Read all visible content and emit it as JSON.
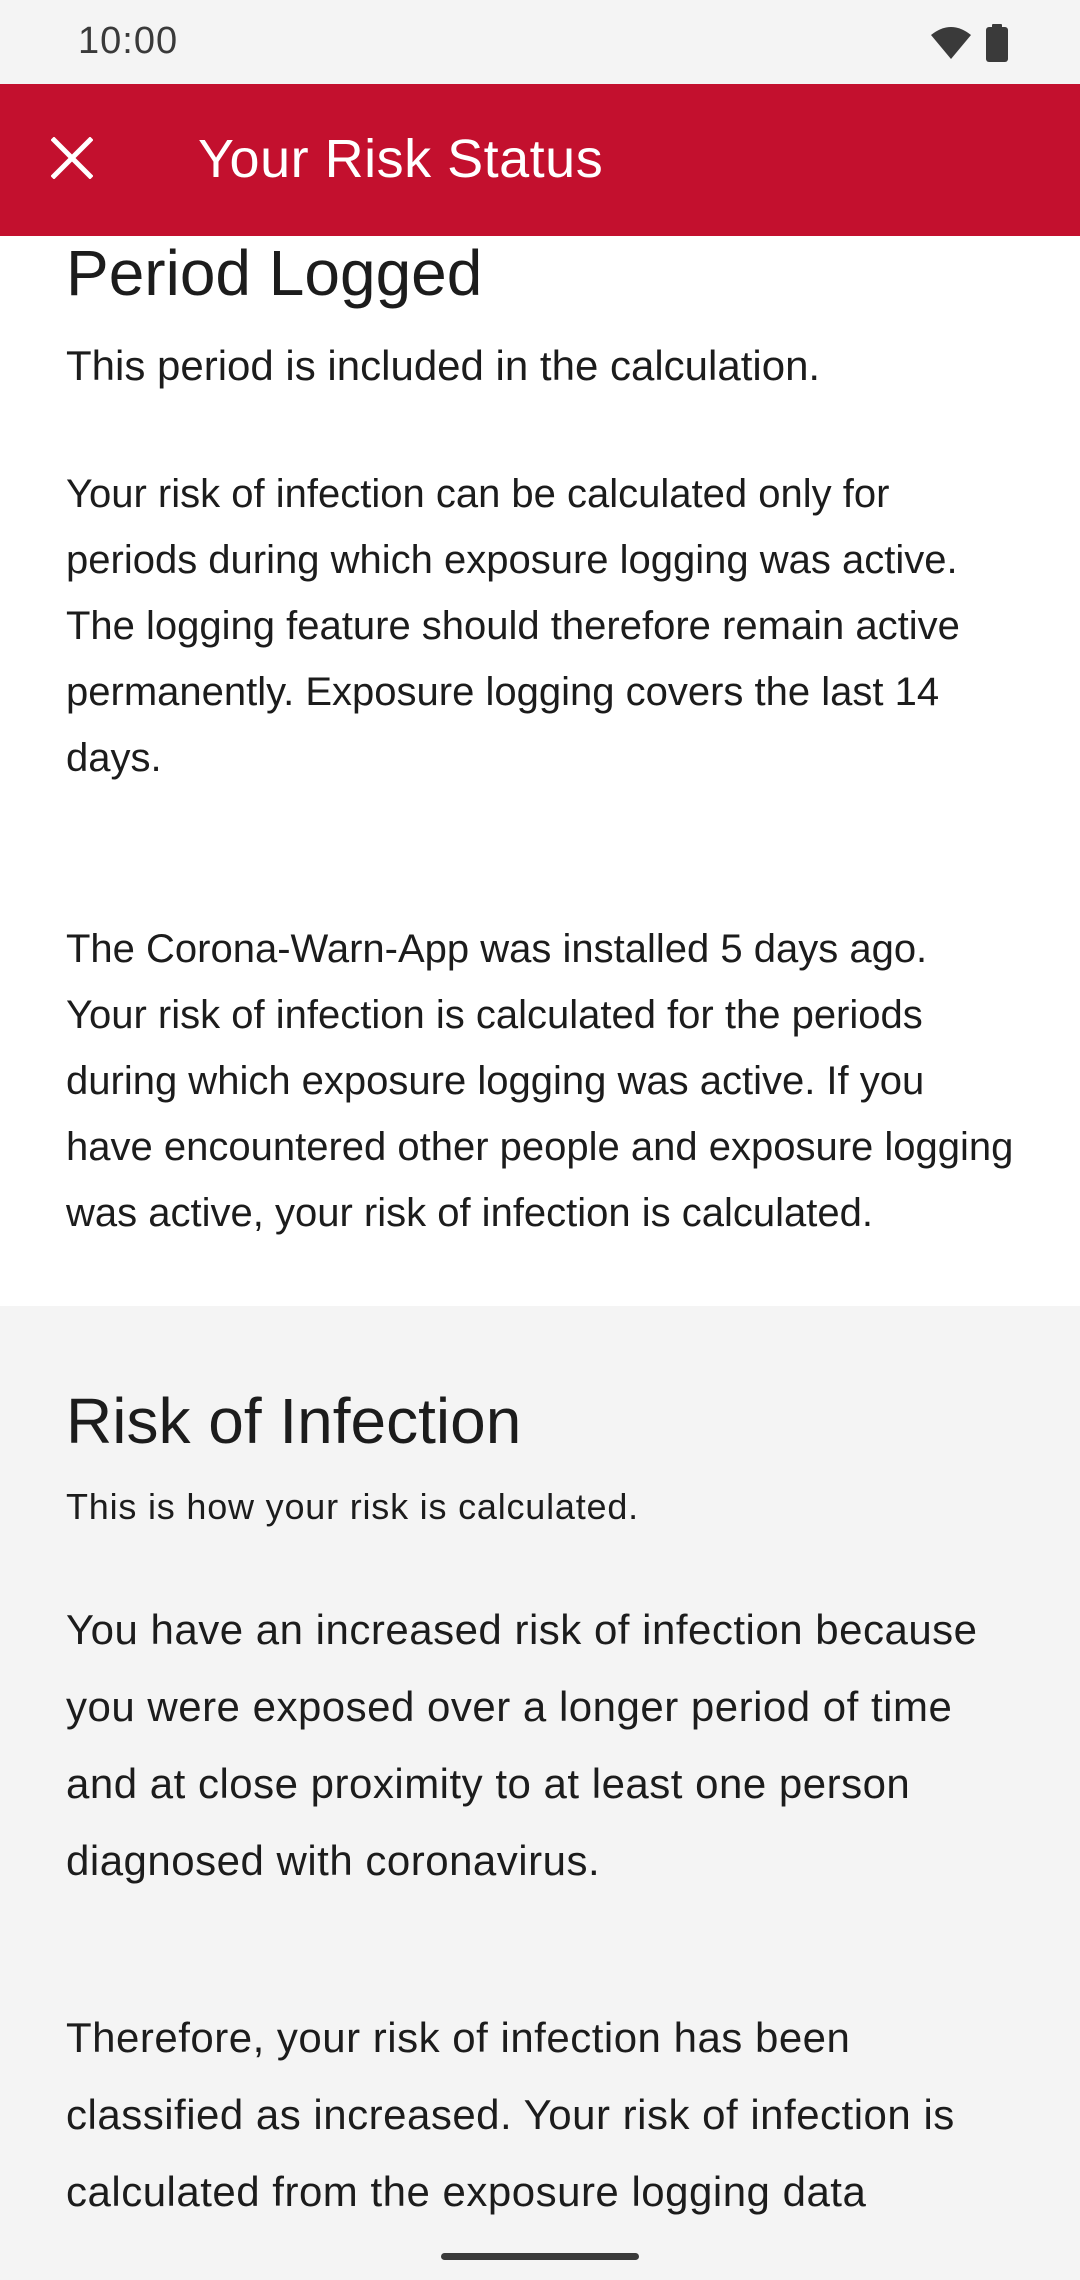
{
  "status_bar": {
    "time": "10:00",
    "icons": [
      "wifi-icon",
      "battery-icon"
    ]
  },
  "app_bar": {
    "title": "Your Risk Status",
    "close_icon": "close-icon",
    "color": "#c3102e"
  },
  "period_section": {
    "heading": "Period Logged",
    "subtitle": "This period is included in the calculation.",
    "paragraph_1": "Your risk of infection can be calculated only for periods during which exposure logging was active. The logging feature should therefore remain active permanently. Exposure logging covers the last 14 days.",
    "paragraph_2": "The Corona-Warn-App was installed 5 days ago. Your risk of infection is calculated for the periods during which exposure logging was active. If you have encountered other people and exposure logging was active, your risk of infection is calculated."
  },
  "risk_section": {
    "heading": "Risk of Infection",
    "subtitle": "This is how your risk is calculated.",
    "paragraph_1": "You have an increased risk of infection because you were exposed over a longer period of time and at close proximity to at least one person diagnosed with coronavirus.",
    "paragraph_2": "Therefore, your risk of infection has been classified as increased. Your risk of infection is calculated from the exposure logging data (duration and proximity) locally on your"
  }
}
